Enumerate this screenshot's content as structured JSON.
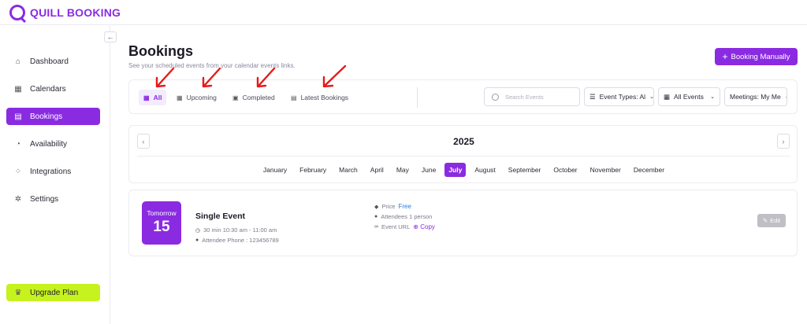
{
  "brand": {
    "name": "QUILL BOOKING",
    "color": "#8a2be2"
  },
  "sidebar": {
    "collapse_icon": "arrow-left-icon",
    "items": [
      {
        "label": "Dashboard",
        "icon": "home-icon"
      },
      {
        "label": "Calendars",
        "icon": "calendar-icon"
      },
      {
        "label": "Bookings",
        "icon": "bookings-icon",
        "active": true
      },
      {
        "label": "Availability",
        "icon": "clock-icon"
      },
      {
        "label": "Integrations",
        "icon": "grid-icon"
      },
      {
        "label": "Settings",
        "icon": "gear-icon"
      }
    ],
    "upgrade_label": "Upgrade Plan"
  },
  "page": {
    "title": "Bookings",
    "subtitle": "See your scheduled events from your calendar events links.",
    "primary_button": "Booking Manually"
  },
  "filters": {
    "tabs": [
      {
        "label": "All",
        "active": true
      },
      {
        "label": "Upcoming"
      },
      {
        "label": "Completed"
      },
      {
        "label": "Latest Bookings"
      }
    ],
    "search_placeholder": "Search Events",
    "event_types": "Event Types: Al",
    "all_events": "All Events",
    "meetings": "Meetings: My Me"
  },
  "calendar": {
    "year": "2025",
    "months": [
      "January",
      "February",
      "March",
      "April",
      "May",
      "June",
      "July",
      "August",
      "September",
      "October",
      "November",
      "December"
    ],
    "active_month": "July"
  },
  "event": {
    "date_label": "Tomorrow",
    "date_number": "15",
    "title": "Single Event",
    "time": "30 min 10:30 am - 11:00 am",
    "attendee_phone": "Attendee Phone : 123456789",
    "price_label": "Price",
    "price_value": "Free",
    "attendees": "Attendees 1 person",
    "url_label": "Event URL",
    "copy_label": "Copy",
    "edit_label": "Edit"
  },
  "colors": {
    "accent": "#8a2be2",
    "upgrade": "#c6f21e",
    "annotation_arrow": "#e41b1b"
  }
}
